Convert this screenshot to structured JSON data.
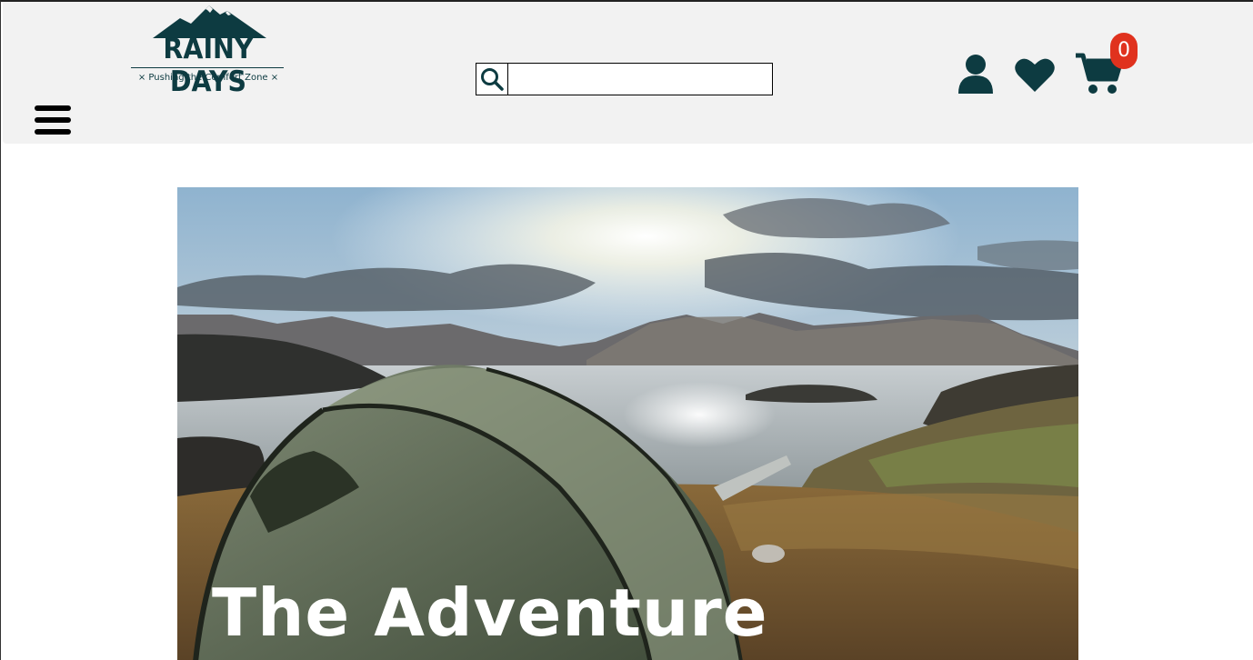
{
  "header": {
    "logo": {
      "name": "RAINY DAYS",
      "tagline": "× Pushing the Comfort Zone ×"
    },
    "search": {
      "value": "",
      "placeholder": ""
    },
    "icons": {
      "menu": "hamburger-menu-icon",
      "search": "search-icon",
      "account": "user-icon",
      "wishlist": "heart-icon",
      "cart": "cart-icon"
    },
    "cart_count": "0",
    "colors": {
      "brand": "#0d3b41",
      "badge": "#e0321e",
      "header_bg": "#f2f2f2"
    }
  },
  "hero": {
    "title": "The Adventure"
  }
}
